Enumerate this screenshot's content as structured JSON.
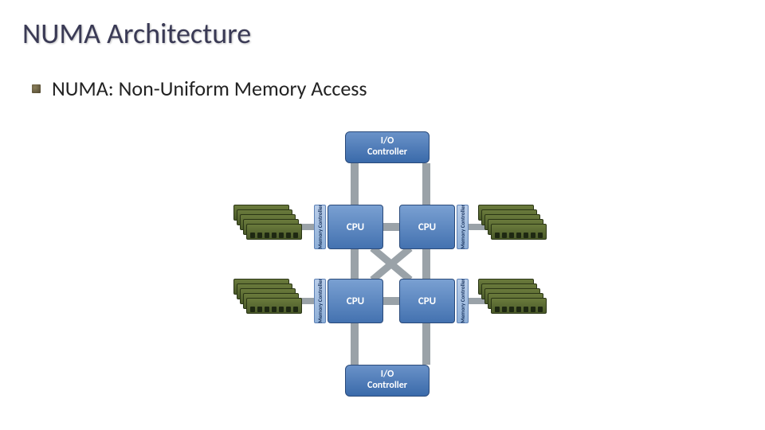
{
  "slide": {
    "title": "NUMA Architecture",
    "subtitle": "NUMA: Non-Uniform Memory Access"
  },
  "diagram": {
    "io_controller_label": "I/O\nController",
    "cpu_label": "CPU",
    "memory_controller_label": "Memory Controller",
    "components": {
      "io_controllers": 2,
      "cpus": 4,
      "memory_controllers": 4,
      "memory_stacks": 4,
      "dimms_per_stack": 5,
      "chips_per_dimm": 7
    },
    "topology": "4 CPU nodes fully interconnected; each CPU has a local memory controller and DIMM stack; two shared I/O controllers (top and bottom)"
  }
}
